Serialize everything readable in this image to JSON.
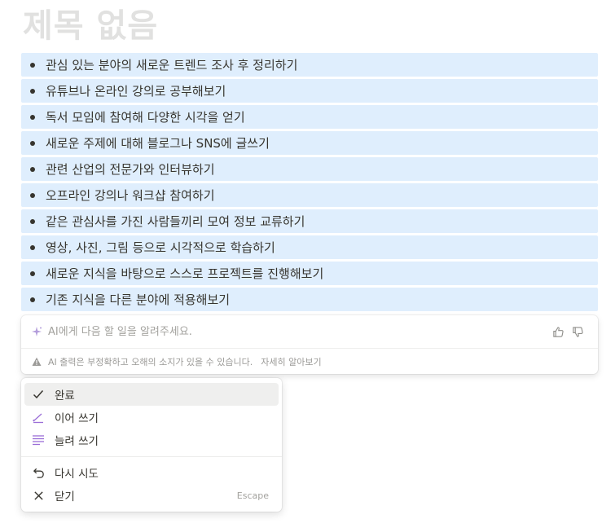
{
  "page": {
    "title": "제목 없음"
  },
  "list": {
    "items": [
      "관심 있는 분야의 새로운 트렌드 조사 후 정리하기",
      "유튜브나 온라인 강의로 공부해보기",
      "독서 모임에 참여해 다양한 시각을 얻기",
      "새로운 주제에 대해 블로그나 SNS에 글쓰기",
      "관련 산업의 전문가와 인터뷰하기",
      "오프라인 강의나 워크샵 참여하기",
      "같은 관심사를 가진 사람들끼리 모여 정보 교류하기",
      "영상, 사진, 그림 등으로 시각적으로 학습하기",
      "새로운 지식을 바탕으로 스스로 프로젝트를 진행해보기",
      "기존 지식을 다른 분야에 적용해보기"
    ]
  },
  "ai": {
    "placeholder": "AI에게 다음 할 일을 알려주세요.",
    "disclaimer": "AI 출력은 부정확하고 오해의 소지가 있을 수 있습니다.",
    "learn_more": "자세히 알아보기"
  },
  "menu": {
    "items": [
      {
        "label": "완료",
        "icon": "check-icon"
      },
      {
        "label": "이어 쓰기",
        "icon": "pencil-icon"
      },
      {
        "label": "늘려 쓰기",
        "icon": "lines-icon"
      },
      {
        "label": "다시 시도",
        "icon": "undo-icon"
      },
      {
        "label": "닫기",
        "icon": "close-icon",
        "shortcut": "Escape"
      }
    ]
  },
  "colors": {
    "highlight": "#dfeefd",
    "accent_purple": "#9a6dd7",
    "text": "#37352f",
    "muted": "#9b9a97"
  }
}
